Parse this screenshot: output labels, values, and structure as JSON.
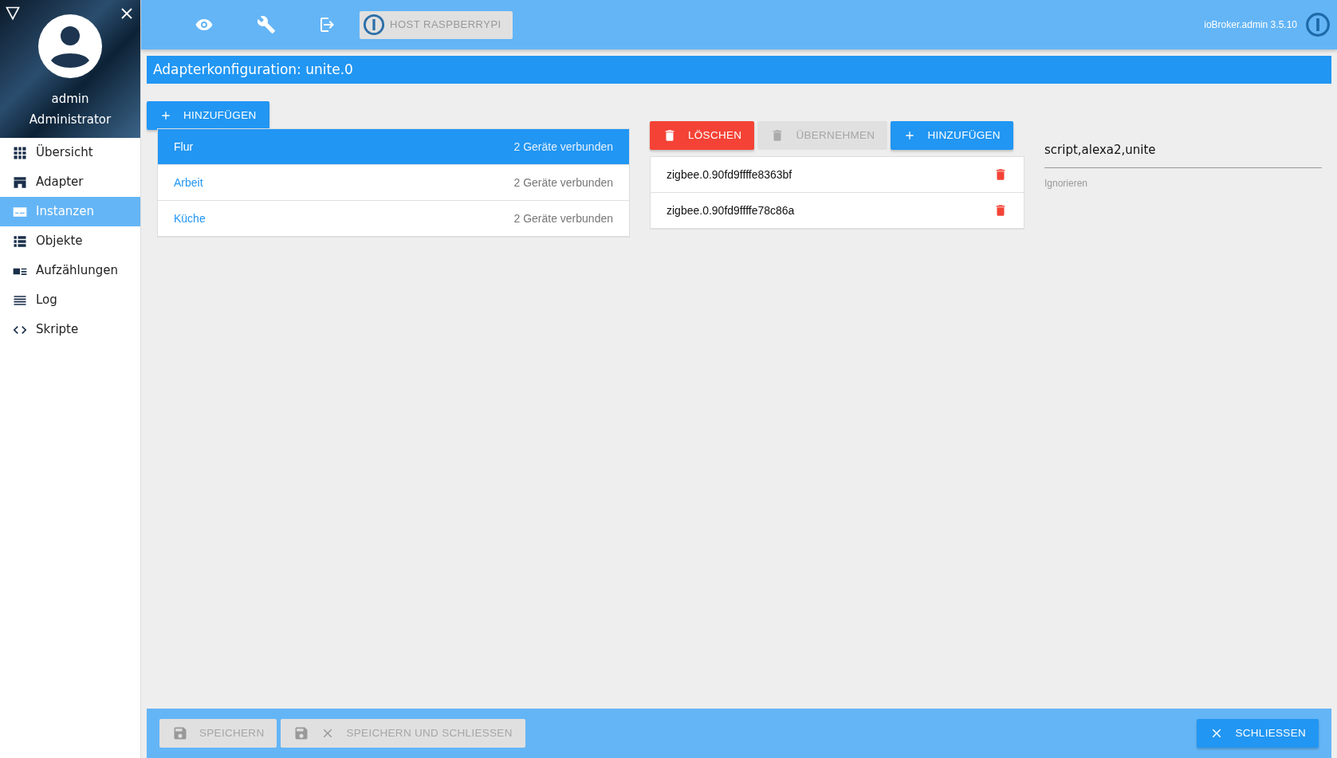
{
  "sidebar": {
    "user": "admin",
    "role": "Administrator",
    "items": [
      {
        "label": "Übersicht",
        "selected": false
      },
      {
        "label": "Adapter",
        "selected": false
      },
      {
        "label": "Instanzen",
        "selected": true
      },
      {
        "label": "Objekte",
        "selected": false
      },
      {
        "label": "Aufzählungen",
        "selected": false
      },
      {
        "label": "Log",
        "selected": false
      },
      {
        "label": "Skripte",
        "selected": false
      }
    ]
  },
  "toolbar": {
    "host_button": "HOST RASPBERRYPI",
    "version": "ioBroker.admin 3.5.10"
  },
  "title": "Adapterkonfiguration: unite.0",
  "add_group_button": "HINZUFÜGEN",
  "groups": [
    {
      "name": "Flur",
      "status": "2 Geräte verbunden",
      "selected": true
    },
    {
      "name": "Arbeit",
      "status": "2 Geräte verbunden",
      "selected": false
    },
    {
      "name": "Küche",
      "status": "2 Geräte verbunden",
      "selected": false
    }
  ],
  "device_actions": [
    {
      "label": "LÖSCHEN",
      "kind": "delete",
      "disabled": false
    },
    {
      "label": "ÜBERNEHMEN",
      "kind": "delete",
      "disabled": true
    },
    {
      "label": "HINZUFÜGEN",
      "kind": "add",
      "disabled": false
    }
  ],
  "devices": [
    {
      "id": "zigbee.0.90fd9ffffe8363bf"
    },
    {
      "id": "zigbee.0.90fd9ffffe78c86a"
    }
  ],
  "ignore_field": {
    "value": "script,alexa2,unite",
    "label": "Ignorieren"
  },
  "footer_buttons": [
    {
      "label": "SPEICHERN",
      "kind": "save",
      "disabled": true
    },
    {
      "label": "SPEICHERN UND SCHLIESSEN",
      "kind": "save_close",
      "disabled": true
    }
  ],
  "close_button": "SCHLIESSEN"
}
